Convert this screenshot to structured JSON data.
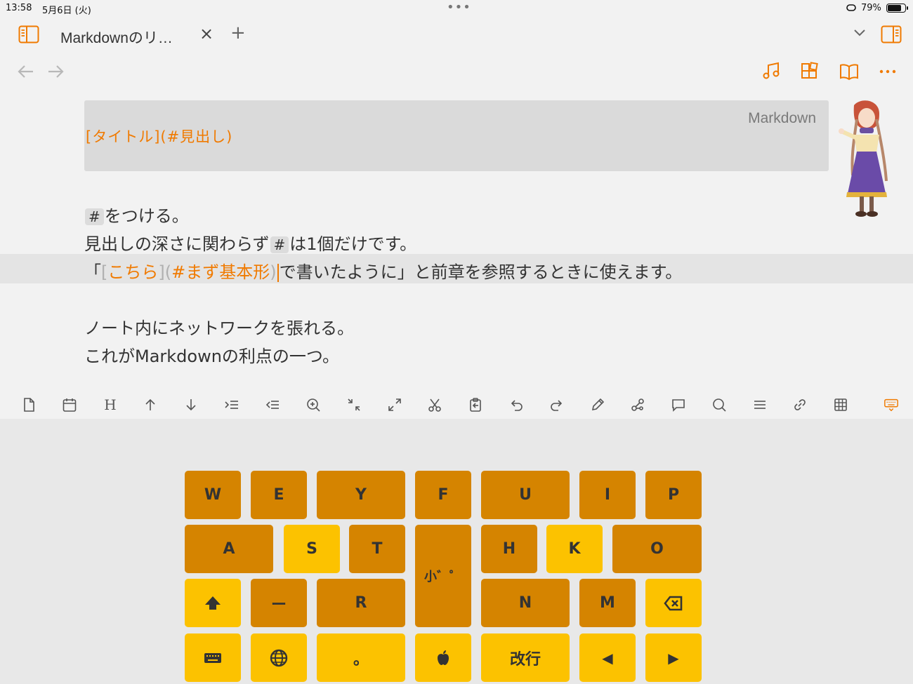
{
  "status": {
    "time": "13:58",
    "date": "5月6日 (火)",
    "battery_pct": "79%",
    "battery_level": 0.79
  },
  "tab": {
    "title": "Markdownのリ…",
    "close": "×",
    "add": "+"
  },
  "code_block": {
    "lang": "Markdown",
    "code": "[タイトル](#見出し)"
  },
  "editor": {
    "line1_hash": "#",
    "line1_text": "をつける。",
    "line2_a": "見出しの深さに関わらず",
    "line2_hash": "#",
    "line2_b": "は1個だけです。",
    "line3_open": "「",
    "line3_lb": "[",
    "line3_link": "こちら",
    "line3_rb": "](",
    "line3_target": "#まず基本形",
    "line3_rp": ")",
    "line3_rest": "で書いたように」と前章を参照するときに使えます。",
    "line4": "ノート内にネットワークを張れる。",
    "line5": "これがMarkdownの利点の一つ。"
  },
  "toolbar": {
    "heading_label": "H"
  },
  "keyboard": {
    "w": "W",
    "e": "E",
    "y": "Y",
    "f": "F",
    "u": "U",
    "i": "I",
    "p": "P",
    "a": "A",
    "s": "S",
    "t": "T",
    "small": "小゛゜",
    "h": "H",
    "k": "K",
    "o": "O",
    "dash": "ー",
    "r": "R",
    "n": "N",
    "m": "M",
    "period": "。",
    "enter": "改行",
    "left": "◀",
    "right": "▶"
  },
  "colors": {
    "accent": "#f07a00",
    "key_dark": "#d58400",
    "key_light": "#fcc200"
  }
}
